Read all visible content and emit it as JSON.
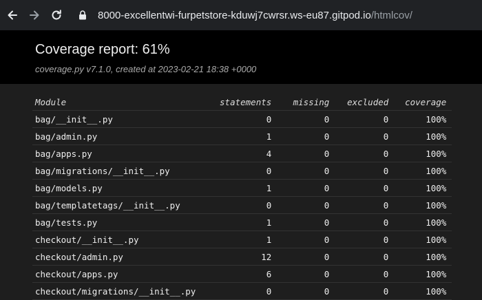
{
  "browser": {
    "url_host": "8000-excellentwi-furpetstore-kduwj7cwrsr.ws-eu87.gitpod.io",
    "url_path": "/htmlcov/"
  },
  "header": {
    "title": "Coverage report: 61%",
    "subtitle_tool": "coverage.py v7.1.0",
    "subtitle_created": ", created at 2023-02-21 18:38 +0000"
  },
  "table": {
    "columns": [
      "Module",
      "statements",
      "missing",
      "excluded",
      "coverage"
    ],
    "rows": [
      {
        "module": "bag/__init__.py",
        "statements": "0",
        "missing": "0",
        "excluded": "0",
        "coverage": "100%"
      },
      {
        "module": "bag/admin.py",
        "statements": "1",
        "missing": "0",
        "excluded": "0",
        "coverage": "100%"
      },
      {
        "module": "bag/apps.py",
        "statements": "4",
        "missing": "0",
        "excluded": "0",
        "coverage": "100%"
      },
      {
        "module": "bag/migrations/__init__.py",
        "statements": "0",
        "missing": "0",
        "excluded": "0",
        "coverage": "100%"
      },
      {
        "module": "bag/models.py",
        "statements": "1",
        "missing": "0",
        "excluded": "0",
        "coverage": "100%"
      },
      {
        "module": "bag/templatetags/__init__.py",
        "statements": "0",
        "missing": "0",
        "excluded": "0",
        "coverage": "100%"
      },
      {
        "module": "bag/tests.py",
        "statements": "1",
        "missing": "0",
        "excluded": "0",
        "coverage": "100%"
      },
      {
        "module": "checkout/__init__.py",
        "statements": "1",
        "missing": "0",
        "excluded": "0",
        "coverage": "100%"
      },
      {
        "module": "checkout/admin.py",
        "statements": "12",
        "missing": "0",
        "excluded": "0",
        "coverage": "100%"
      },
      {
        "module": "checkout/apps.py",
        "statements": "6",
        "missing": "0",
        "excluded": "0",
        "coverage": "100%"
      },
      {
        "module": "checkout/migrations/__init__.py",
        "statements": "0",
        "missing": "0",
        "excluded": "0",
        "coverage": "100%"
      }
    ]
  }
}
